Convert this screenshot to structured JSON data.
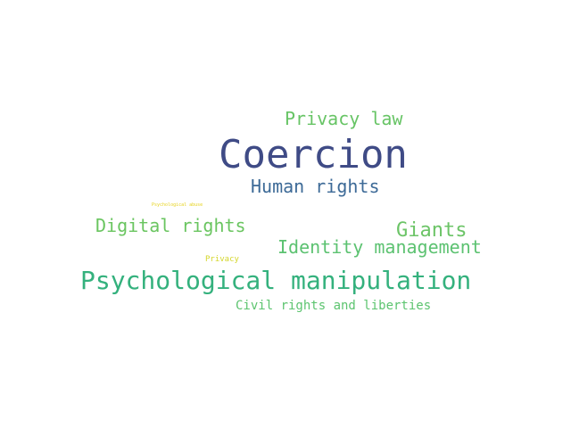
{
  "words": [
    {
      "text": "Coercion",
      "color": "#3f4b86"
    },
    {
      "text": "Psychological manipulation",
      "color": "#34b17d"
    },
    {
      "text": "Human rights",
      "color": "#3d6a97"
    },
    {
      "text": "Privacy law",
      "color": "#67c465"
    },
    {
      "text": "Digital rights",
      "color": "#6ac560"
    },
    {
      "text": "Giants",
      "color": "#6cc467"
    },
    {
      "text": "Identity management",
      "color": "#5cc271"
    },
    {
      "text": "Civil rights and liberties",
      "color": "#5cc46f"
    },
    {
      "text": "Privacy",
      "color": "#d4d62b"
    },
    {
      "text": "Psychological abuse",
      "color": "#e6d21b"
    }
  ]
}
